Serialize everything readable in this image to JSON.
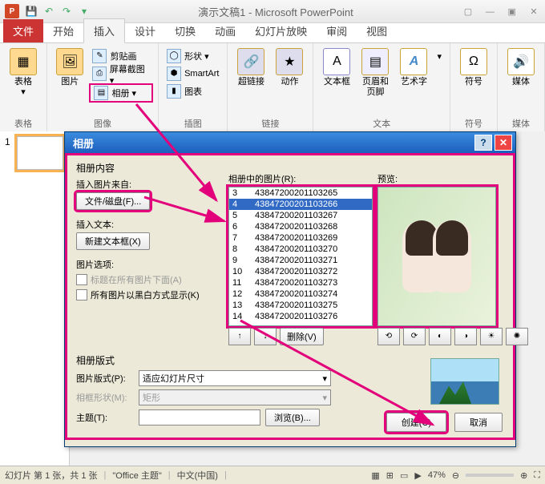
{
  "window": {
    "title": "演示文稿1 - Microsoft PowerPoint"
  },
  "qat": {
    "save": "💾",
    "undo": "↶",
    "redo": "↷"
  },
  "tabs": {
    "file": "文件",
    "home": "开始",
    "insert": "插入",
    "design": "设计",
    "transitions": "切换",
    "animations": "动画",
    "slideshow": "幻灯片放映",
    "review": "审阅",
    "view": "视图"
  },
  "ribbon": {
    "tables": {
      "label": "表格",
      "btn": "表格"
    },
    "images": {
      "label": "图像",
      "pic": "图片",
      "clipart": "剪贴画",
      "screenshot": "屏幕截图 ▾",
      "album": "相册 ▾"
    },
    "illus": {
      "label": "插图",
      "shapes": "形状 ▾",
      "smartart": "SmartArt",
      "chart": "图表"
    },
    "links": {
      "label": "链接",
      "hyperlink": "超链接",
      "action": "动作"
    },
    "text": {
      "label": "文本",
      "textbox": "文本框",
      "headerfooter": "页眉和页脚",
      "wordart": "艺术字",
      "more": "▾"
    },
    "symbols": {
      "label": "符号",
      "btn": "符号"
    },
    "media": {
      "label": "媒体",
      "btn": "媒体"
    }
  },
  "thumb": {
    "num": "1"
  },
  "dialog": {
    "title": "相册",
    "content_label": "相册内容",
    "insert_from_label": "插入图片来自:",
    "file_disk_btn": "文件/磁盘(F)...",
    "insert_text_label": "插入文本:",
    "new_textbox_btn": "新建文本框(X)",
    "pic_options_label": "图片选项:",
    "caption_check": "标题在所有图片下面(A)",
    "bw_check": "所有图片以黑白方式显示(K)",
    "pics_in_album": "相册中的图片(R):",
    "preview_label": "预览:",
    "list": [
      {
        "n": "3",
        "f": "43847200201103265"
      },
      {
        "n": "4",
        "f": "43847200201103266"
      },
      {
        "n": "5",
        "f": "43847200201103267"
      },
      {
        "n": "6",
        "f": "43847200201103268"
      },
      {
        "n": "7",
        "f": "43847200201103269"
      },
      {
        "n": "8",
        "f": "43847200201103270"
      },
      {
        "n": "9",
        "f": "43847200201103271"
      },
      {
        "n": "10",
        "f": "43847200201103272"
      },
      {
        "n": "11",
        "f": "43847200201103273"
      },
      {
        "n": "12",
        "f": "43847200201103274"
      },
      {
        "n": "13",
        "f": "43847200201103275"
      },
      {
        "n": "14",
        "f": "43847200201103276"
      }
    ],
    "move_up": "↑",
    "move_down": "↓",
    "remove": "删除(V)",
    "layout_label": "相册版式",
    "pic_layout": "图片版式(P):",
    "pic_layout_val": "适应幻灯片尺寸",
    "frame_shape": "相框形状(M):",
    "frame_shape_val": "矩形",
    "theme": "主题(T):",
    "browse": "浏览(B)...",
    "create": "创建(C)",
    "cancel": "取消"
  },
  "status": {
    "slide": "幻灯片 第 1 张，共 1 张",
    "theme": "\"Office 主题\"",
    "lang": "中文(中国)",
    "zoom": "47%"
  },
  "chart_data": null
}
